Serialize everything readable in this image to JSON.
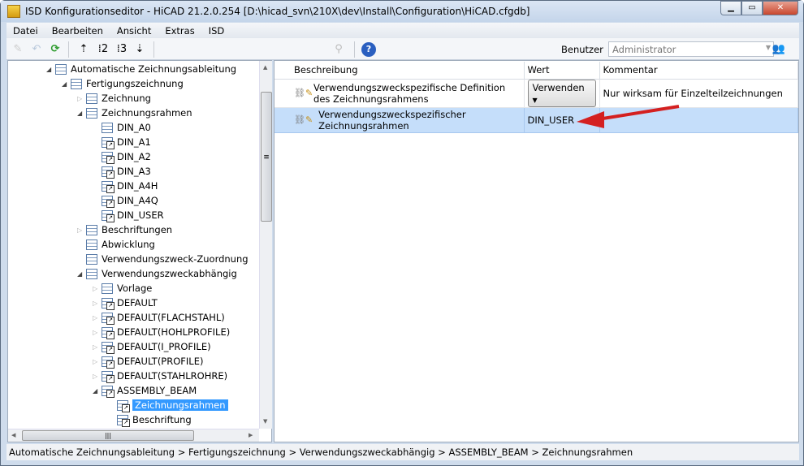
{
  "window": {
    "title": "ISD Konfigurationseditor  - HiCAD 21.2.0.254 [D:\\hicad_svn\\210X\\dev\\Install\\Configuration\\HiCAD.cfgdb]"
  },
  "menu": [
    "Datei",
    "Bearbeiten",
    "Ansicht",
    "Extras",
    "ISD"
  ],
  "toolbar": {
    "user_label": "Benutzer",
    "user_value": "Administrator"
  },
  "tree": [
    {
      "label": "Automatische Zeichnungsableitung",
      "level": 0,
      "state": "expanded",
      "linked": false
    },
    {
      "label": "Fertigungszeichnung",
      "level": 1,
      "state": "expanded",
      "linked": false
    },
    {
      "label": "Zeichnung",
      "level": 2,
      "state": "collapsed",
      "linked": false
    },
    {
      "label": "Zeichnungsrahmen",
      "level": 2,
      "state": "expanded",
      "linked": false
    },
    {
      "label": "DIN_A0",
      "level": 3,
      "state": "leaf",
      "linked": false
    },
    {
      "label": "DIN_A1",
      "level": 3,
      "state": "leaf",
      "linked": true
    },
    {
      "label": "DIN_A2",
      "level": 3,
      "state": "leaf",
      "linked": true
    },
    {
      "label": "DIN_A3",
      "level": 3,
      "state": "leaf",
      "linked": true
    },
    {
      "label": "DIN_A4H",
      "level": 3,
      "state": "leaf",
      "linked": true
    },
    {
      "label": "DIN_A4Q",
      "level": 3,
      "state": "leaf",
      "linked": true
    },
    {
      "label": "DIN_USER",
      "level": 3,
      "state": "leaf",
      "linked": true
    },
    {
      "label": "Beschriftungen",
      "level": 2,
      "state": "collapsed",
      "linked": false
    },
    {
      "label": "Abwicklung",
      "level": 2,
      "state": "leaf",
      "linked": false
    },
    {
      "label": "Verwendungszweck-Zuordnung",
      "level": 2,
      "state": "leaf",
      "linked": false
    },
    {
      "label": "Verwendungszweckabhängig",
      "level": 2,
      "state": "expanded",
      "linked": false
    },
    {
      "label": "Vorlage",
      "level": 3,
      "state": "collapsed",
      "linked": false
    },
    {
      "label": "DEFAULT",
      "level": 3,
      "state": "collapsed",
      "linked": true
    },
    {
      "label": "DEFAULT(FLACHSTAHL)",
      "level": 3,
      "state": "collapsed",
      "linked": true
    },
    {
      "label": "DEFAULT(HOHLPROFILE)",
      "level": 3,
      "state": "collapsed",
      "linked": true
    },
    {
      "label": "DEFAULT(I_PROFILE)",
      "level": 3,
      "state": "collapsed",
      "linked": true
    },
    {
      "label": "DEFAULT(PROFILE)",
      "level": 3,
      "state": "collapsed",
      "linked": true
    },
    {
      "label": "DEFAULT(STAHLROHRE)",
      "level": 3,
      "state": "collapsed",
      "linked": true
    },
    {
      "label": "ASSEMBLY_BEAM",
      "level": 3,
      "state": "expanded",
      "linked": true
    },
    {
      "label": "Zeichnungsrahmen",
      "level": 4,
      "state": "leaf",
      "linked": true,
      "selected": true
    },
    {
      "label": "Beschriftung",
      "level": 4,
      "state": "leaf",
      "linked": true
    }
  ],
  "table": {
    "headers": [
      "Beschreibung",
      "Wert",
      "Kommentar"
    ],
    "rows": [
      {
        "description": "Verwendungszweckspezifische Definition des Zeichnungsrahmens",
        "value": "Verwenden",
        "comment": "Nur wirksam für Einzelteilzeichnungen"
      },
      {
        "description": "Verwendungszweckspezifischer Zeichnungsrahmen",
        "value": "DIN_USER",
        "comment": ""
      }
    ]
  },
  "statusbar": "Automatische Zeichnungsableitung > Fertigungszeichnung > Verwendungszweckabhängig > ASSEMBLY_BEAM > Zeichnungsrahmen",
  "colors": {
    "selection": "#3399ff",
    "row_highlight": "#c5defa",
    "arrow": "#d42020"
  }
}
